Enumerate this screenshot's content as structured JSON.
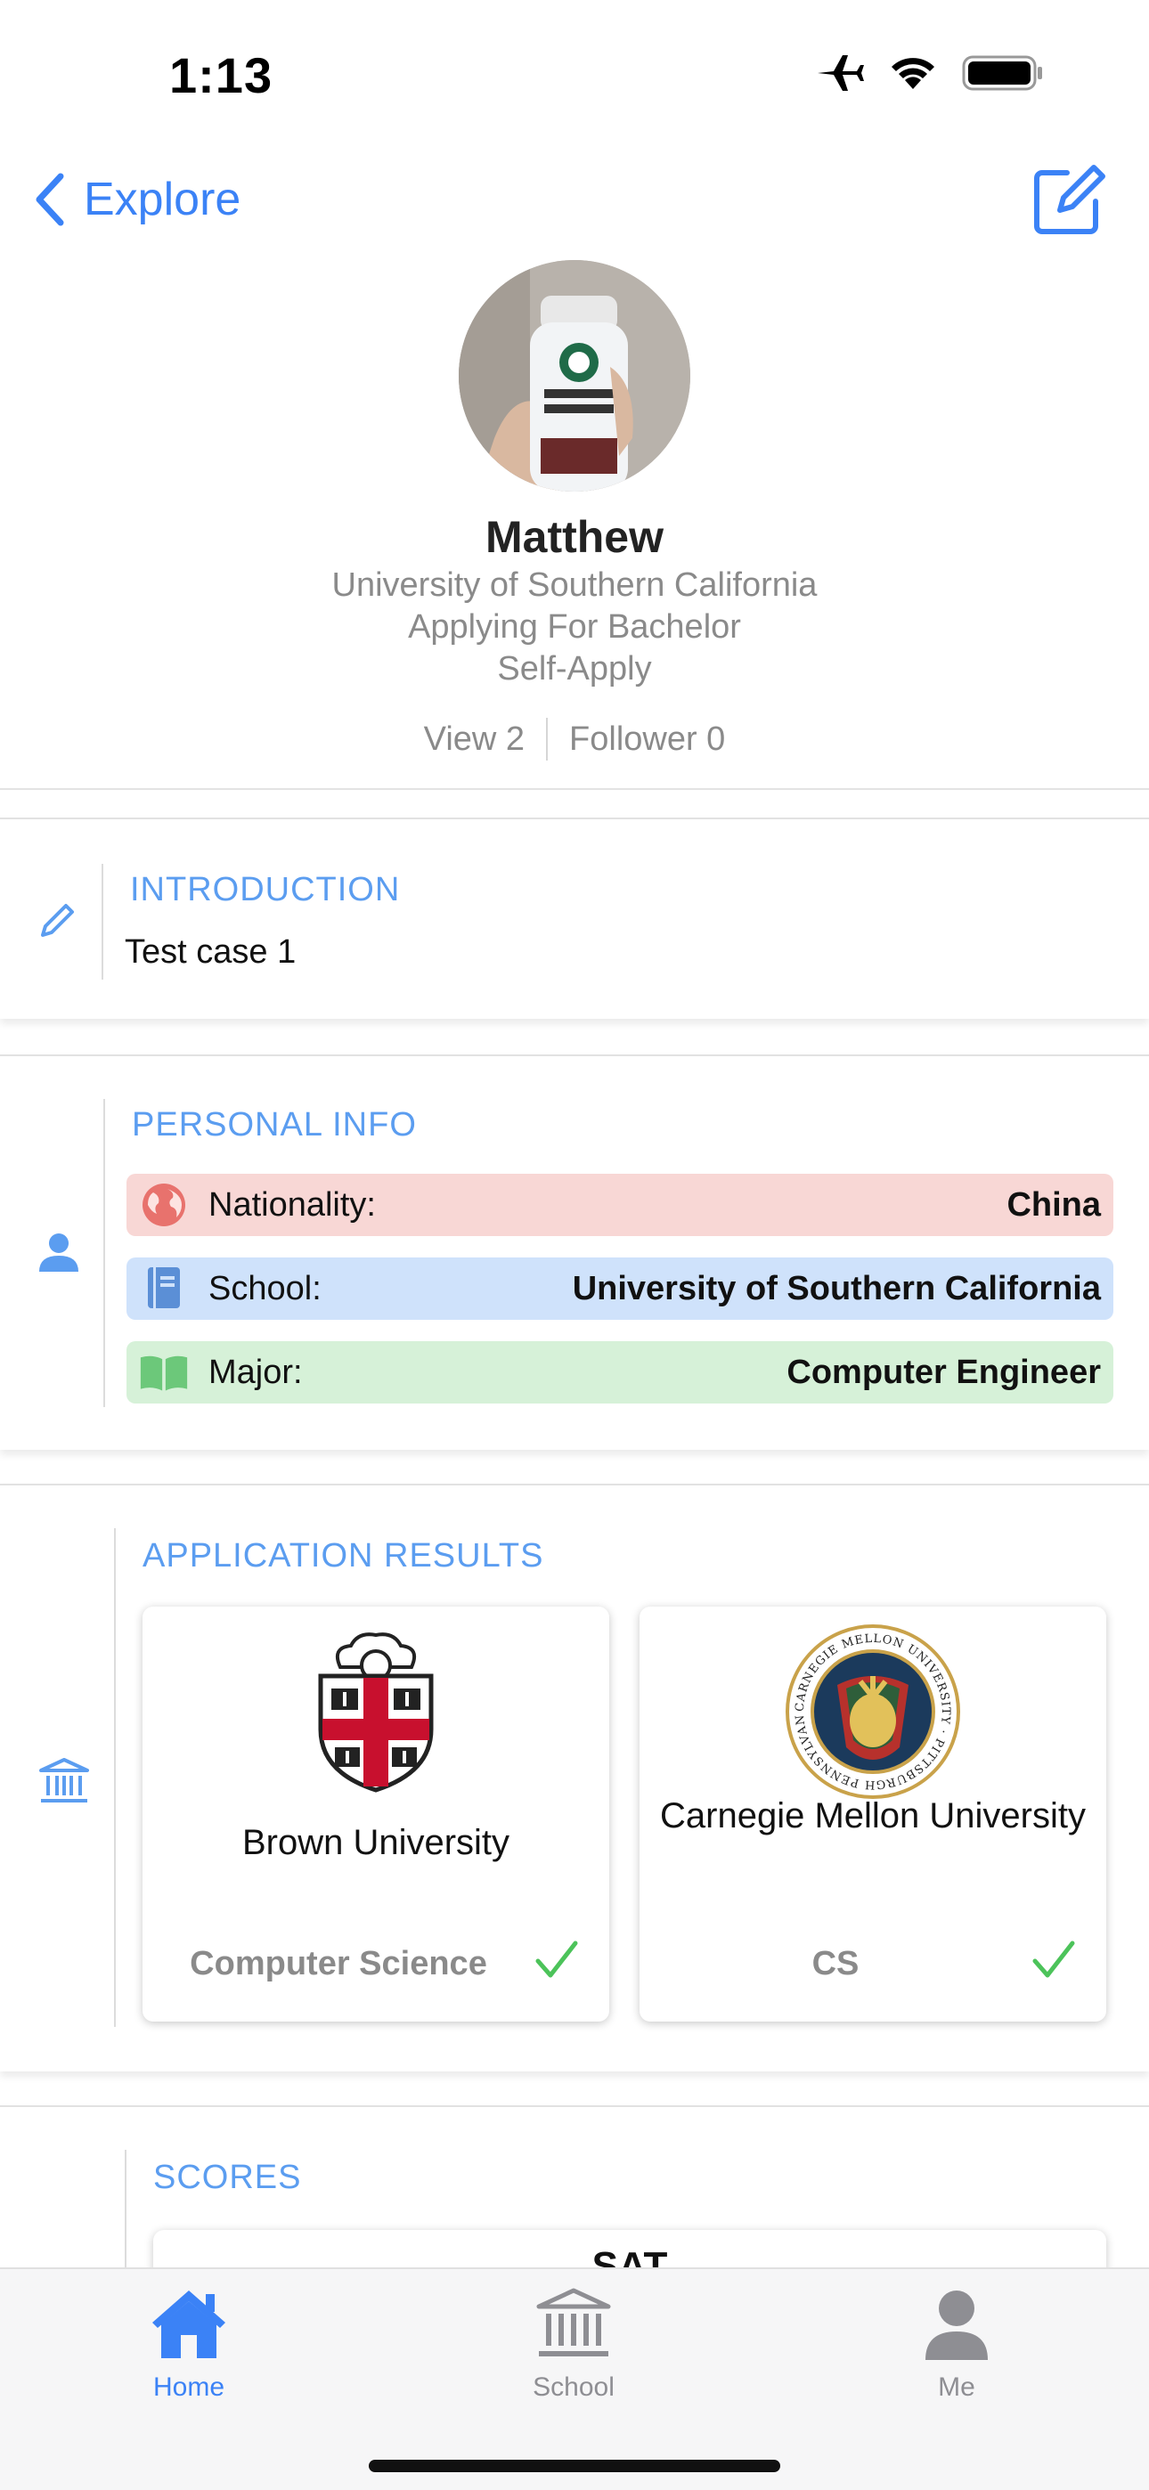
{
  "status_bar": {
    "time": "1:13",
    "icons": [
      "airplane-icon",
      "wifi-icon",
      "battery-icon"
    ]
  },
  "nav": {
    "back_label": "Explore",
    "edit_icon": "compose-icon"
  },
  "profile": {
    "name": "Matthew",
    "school": "University of Southern California",
    "applying": "Applying For Bachelor",
    "apply_type": "Self-Apply",
    "views": "View 2",
    "followers": "Follower 0"
  },
  "introduction": {
    "title": "INTRODUCTION",
    "text": "Test case 1"
  },
  "personal_info": {
    "title": "PERSONAL INFO",
    "rows": [
      {
        "label": "Nationality:",
        "value": "China"
      },
      {
        "label": "School:",
        "value": "University of Southern California"
      },
      {
        "label": "Major:",
        "value": "Computer Engineer"
      }
    ]
  },
  "application_results": {
    "title": "APPLICATION RESULTS",
    "items": [
      {
        "university": "Brown University",
        "major": "Computer Science"
      },
      {
        "university": "Carnegie Mellon University",
        "major": "CS"
      }
    ],
    "cmu_seal_text": "CARNEGIE MELLON UNIVERSITY · PITTSBURGH PENNSYLVANIA 1900"
  },
  "scores": {
    "title": "SCORES",
    "first_test": "SAT"
  },
  "tabbar": {
    "tabs": [
      {
        "label": "Home",
        "active": true
      },
      {
        "label": "School",
        "active": false
      },
      {
        "label": "Me",
        "active": false
      }
    ]
  },
  "colors": {
    "accent": "#3b82f6",
    "section_title": "#5b9df0",
    "check": "#4cc35a",
    "red_row": "#f8d7d5",
    "blue_row": "#cfe2fb",
    "green_row": "#d6f1d8"
  }
}
